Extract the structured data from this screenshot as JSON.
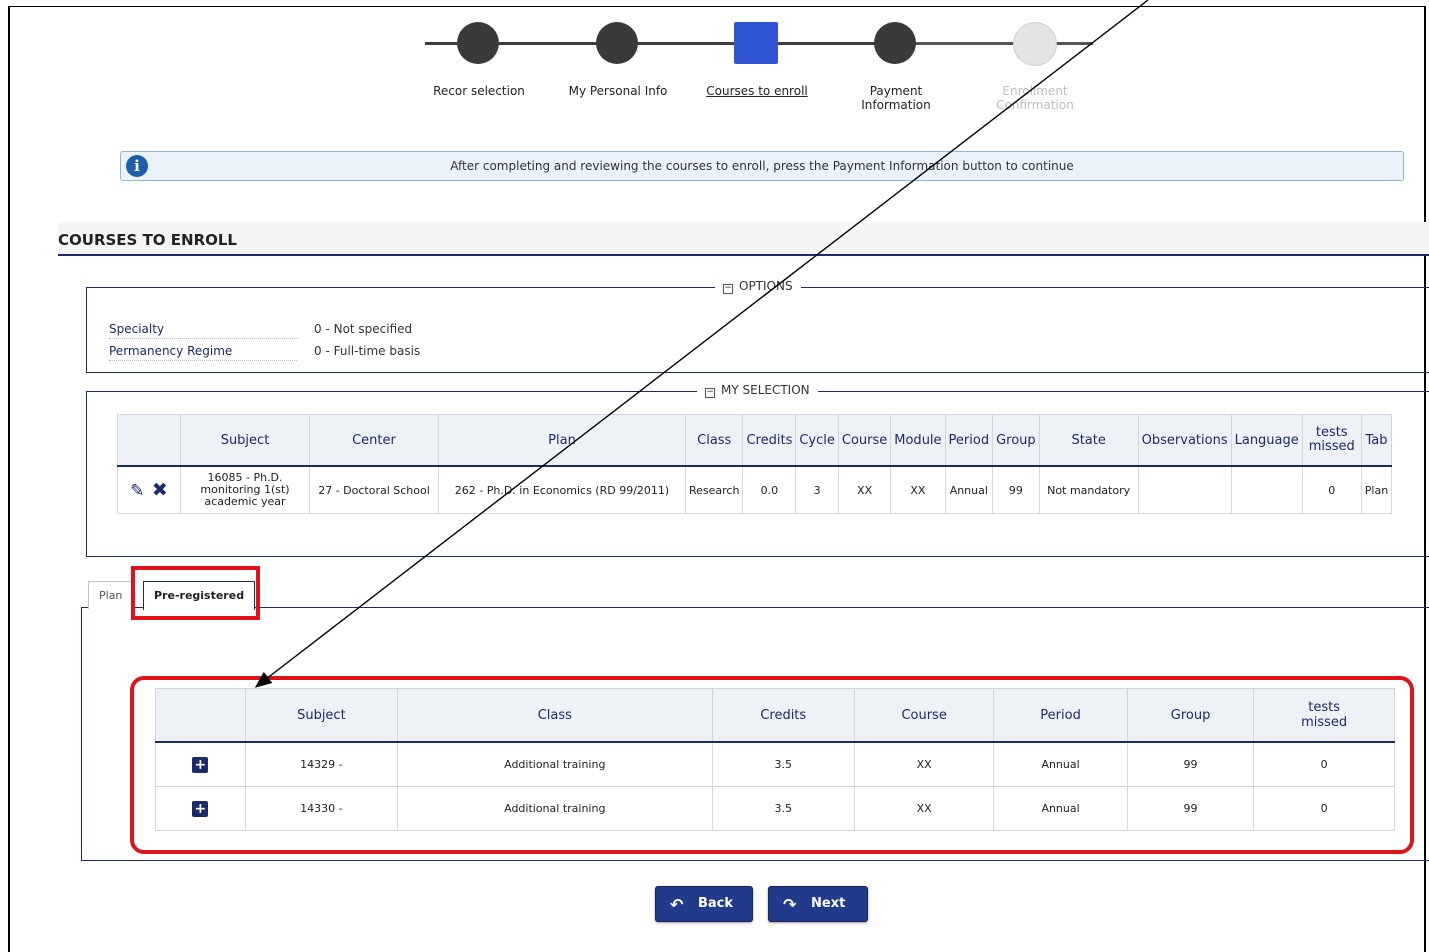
{
  "stepper": {
    "steps": [
      {
        "label": "Recor selection",
        "state": "done"
      },
      {
        "label": "My Personal Info",
        "state": "done"
      },
      {
        "label": "Courses to enroll",
        "state": "current"
      },
      {
        "label": "Payment Information",
        "state": "done"
      },
      {
        "label": "Enrollment Confirmation",
        "state": "pending"
      }
    ]
  },
  "info_message": "After completing and reviewing the courses to enroll, press the Payment Information button to continue",
  "page_title": "COURSES TO ENROLL",
  "options": {
    "legend": "OPTIONS",
    "rows": [
      {
        "key": "Specialty",
        "value": "0 - Not specified"
      },
      {
        "key": "Permanency Regime",
        "value": "0 - Full-time basis"
      }
    ]
  },
  "my_selection": {
    "legend": "MY SELECTION",
    "headers": [
      "",
      "Subject",
      "Center",
      "Plan",
      "Class",
      "Credits",
      "Cycle",
      "Course",
      "Module",
      "Period",
      "Group",
      "State",
      "Observations",
      "Language",
      "tests missed",
      "Tab"
    ],
    "row": {
      "subject": "16085 - Ph.D. monitoring 1(st) academic year",
      "center": "27 - Doctoral School",
      "plan": "262 - Ph.D. in Economics (RD 99/2011)",
      "class": "Research",
      "credits": "0.0",
      "cycle": "3",
      "course": "XX",
      "module": "XX",
      "period": "Annual",
      "group": "99",
      "state": "Not mandatory",
      "observations": "",
      "language": "",
      "tests_missed": "0",
      "tab": "Plan"
    }
  },
  "tabs": [
    {
      "label": "Plan",
      "active": false
    },
    {
      "label": "Pre-registered",
      "active": true
    }
  ],
  "pre_registered": {
    "headers": [
      "",
      "Subject",
      "Class",
      "Credits",
      "Course",
      "Period",
      "Group",
      "tests missed"
    ],
    "rows": [
      {
        "subject": "14329 -",
        "class": "Additional training",
        "credits": "3.5",
        "course": "XX",
        "period": "Annual",
        "group": "99",
        "tests_missed": "0"
      },
      {
        "subject": "14330 -",
        "class": "Additional training",
        "credits": "3.5",
        "course": "XX",
        "period": "Annual",
        "group": "99",
        "tests_missed": "0"
      }
    ]
  },
  "buttons": {
    "back": "Back",
    "next": "Next"
  },
  "colors": {
    "accent": "#1b2a6b",
    "current_step": "#2f55d4",
    "highlight": "#e0121a",
    "button": "#213a89"
  }
}
